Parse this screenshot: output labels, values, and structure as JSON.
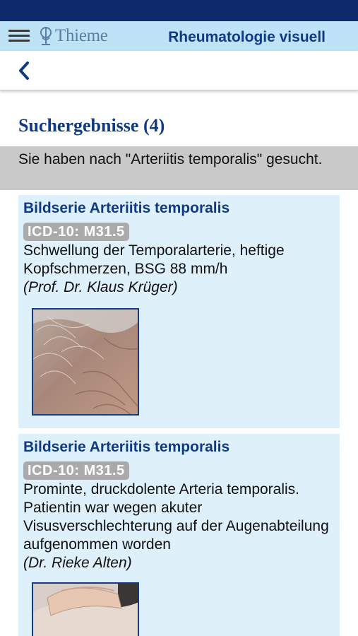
{
  "header": {
    "brand": "Thieme",
    "title": "Rheumatologie visuell",
    "menu_icon": "hamburger-menu-icon",
    "back_icon": "chevron-left-icon"
  },
  "page": {
    "title": "Suchergebnisse (4)",
    "query_message": "Sie haben nach \"Arteriitis temporalis\" gesucht."
  },
  "results": [
    {
      "title": "Bildserie Arteriitis temporalis",
      "badge": "ICD-10: M31.5",
      "description": "Schwellung der Temporalarterie, heftige Kopfschmerzen, BSG 88 mm/h",
      "author": "(Prof. Dr. Klaus Krüger)"
    },
    {
      "title": "Bildserie Arteriitis temporalis",
      "badge": "ICD-10: M31.5",
      "description": "Prominte, druckdolente Arteria temporalis. Patientin war wegen akuter Visusverschlechterung auf der Augenabteilung aufgenommen worden",
      "author": "(Dr. Rieke Alten)"
    }
  ],
  "colors": {
    "status_bar": "#0d2a6b",
    "header_bg": "#bfe3f6",
    "accent": "#103a82",
    "card_bg": "#def0fa",
    "banner_bg": "#c9c9c9",
    "badge_bg": "#aaaaaa"
  }
}
